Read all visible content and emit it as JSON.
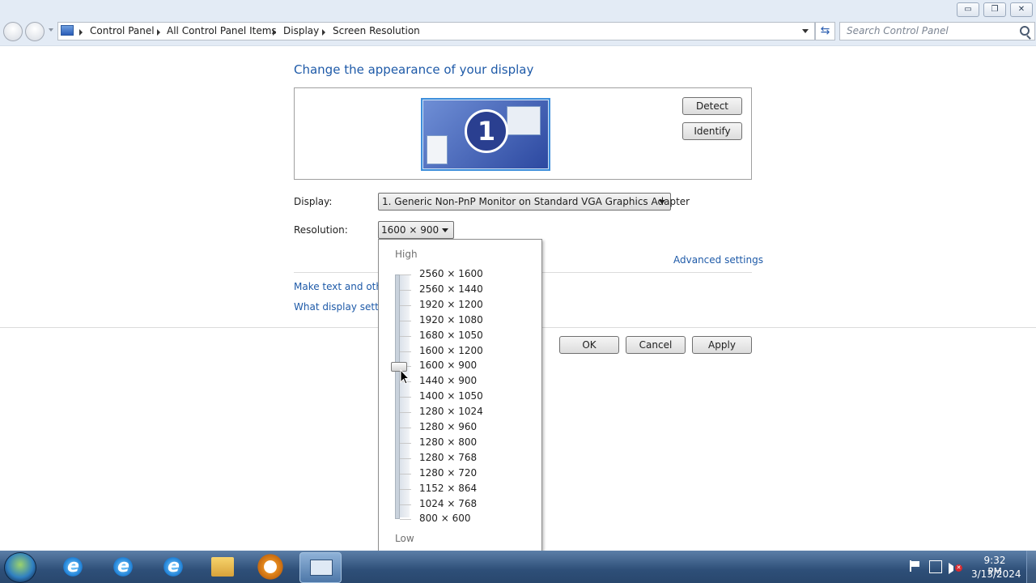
{
  "window": {
    "minimize": "▭",
    "maximize": "❐",
    "close": "✕"
  },
  "address": {
    "breadcrumbs": [
      "Control Panel",
      "All Control Panel Items",
      "Display",
      "Screen Resolution"
    ],
    "search_placeholder": "Search Control Panel"
  },
  "page": {
    "title": "Change the appearance of your display",
    "monitor_number": "1",
    "detect_label": "Detect",
    "identify_label": "Identify",
    "display_label": "Display:",
    "display_value": "1. Generic Non-PnP Monitor on Standard VGA Graphics Adapter",
    "resolution_label": "Resolution:",
    "resolution_value": "1600 × 900",
    "advanced_link": "Advanced settings",
    "link_text_size": "Make text and other",
    "link_display_settings": "What display setting",
    "ok_label": "OK",
    "cancel_label": "Cancel",
    "apply_label": "Apply"
  },
  "resolution_dropdown": {
    "high_label": "High",
    "low_label": "Low",
    "options": [
      "2560 × 1600",
      "2560 × 1440",
      "1920 × 1200",
      "1920 × 1080",
      "1680 × 1050",
      "1600 × 1200",
      "1600 × 900",
      "1440 × 900",
      "1400 × 1050",
      "1280 × 1024",
      "1280 × 960",
      "1280 × 800",
      "1280 × 768",
      "1280 × 720",
      "1152 × 864",
      "1024 × 768",
      "800 × 600"
    ],
    "selected_index": 6
  },
  "taskbar": {
    "clock_time": "9:32 PM",
    "clock_date": "3/13/2024"
  },
  "colors": {
    "accent_link": "#1e5aa8",
    "chrome": "#e3ebf5",
    "taskbar": "#2e4f78"
  }
}
